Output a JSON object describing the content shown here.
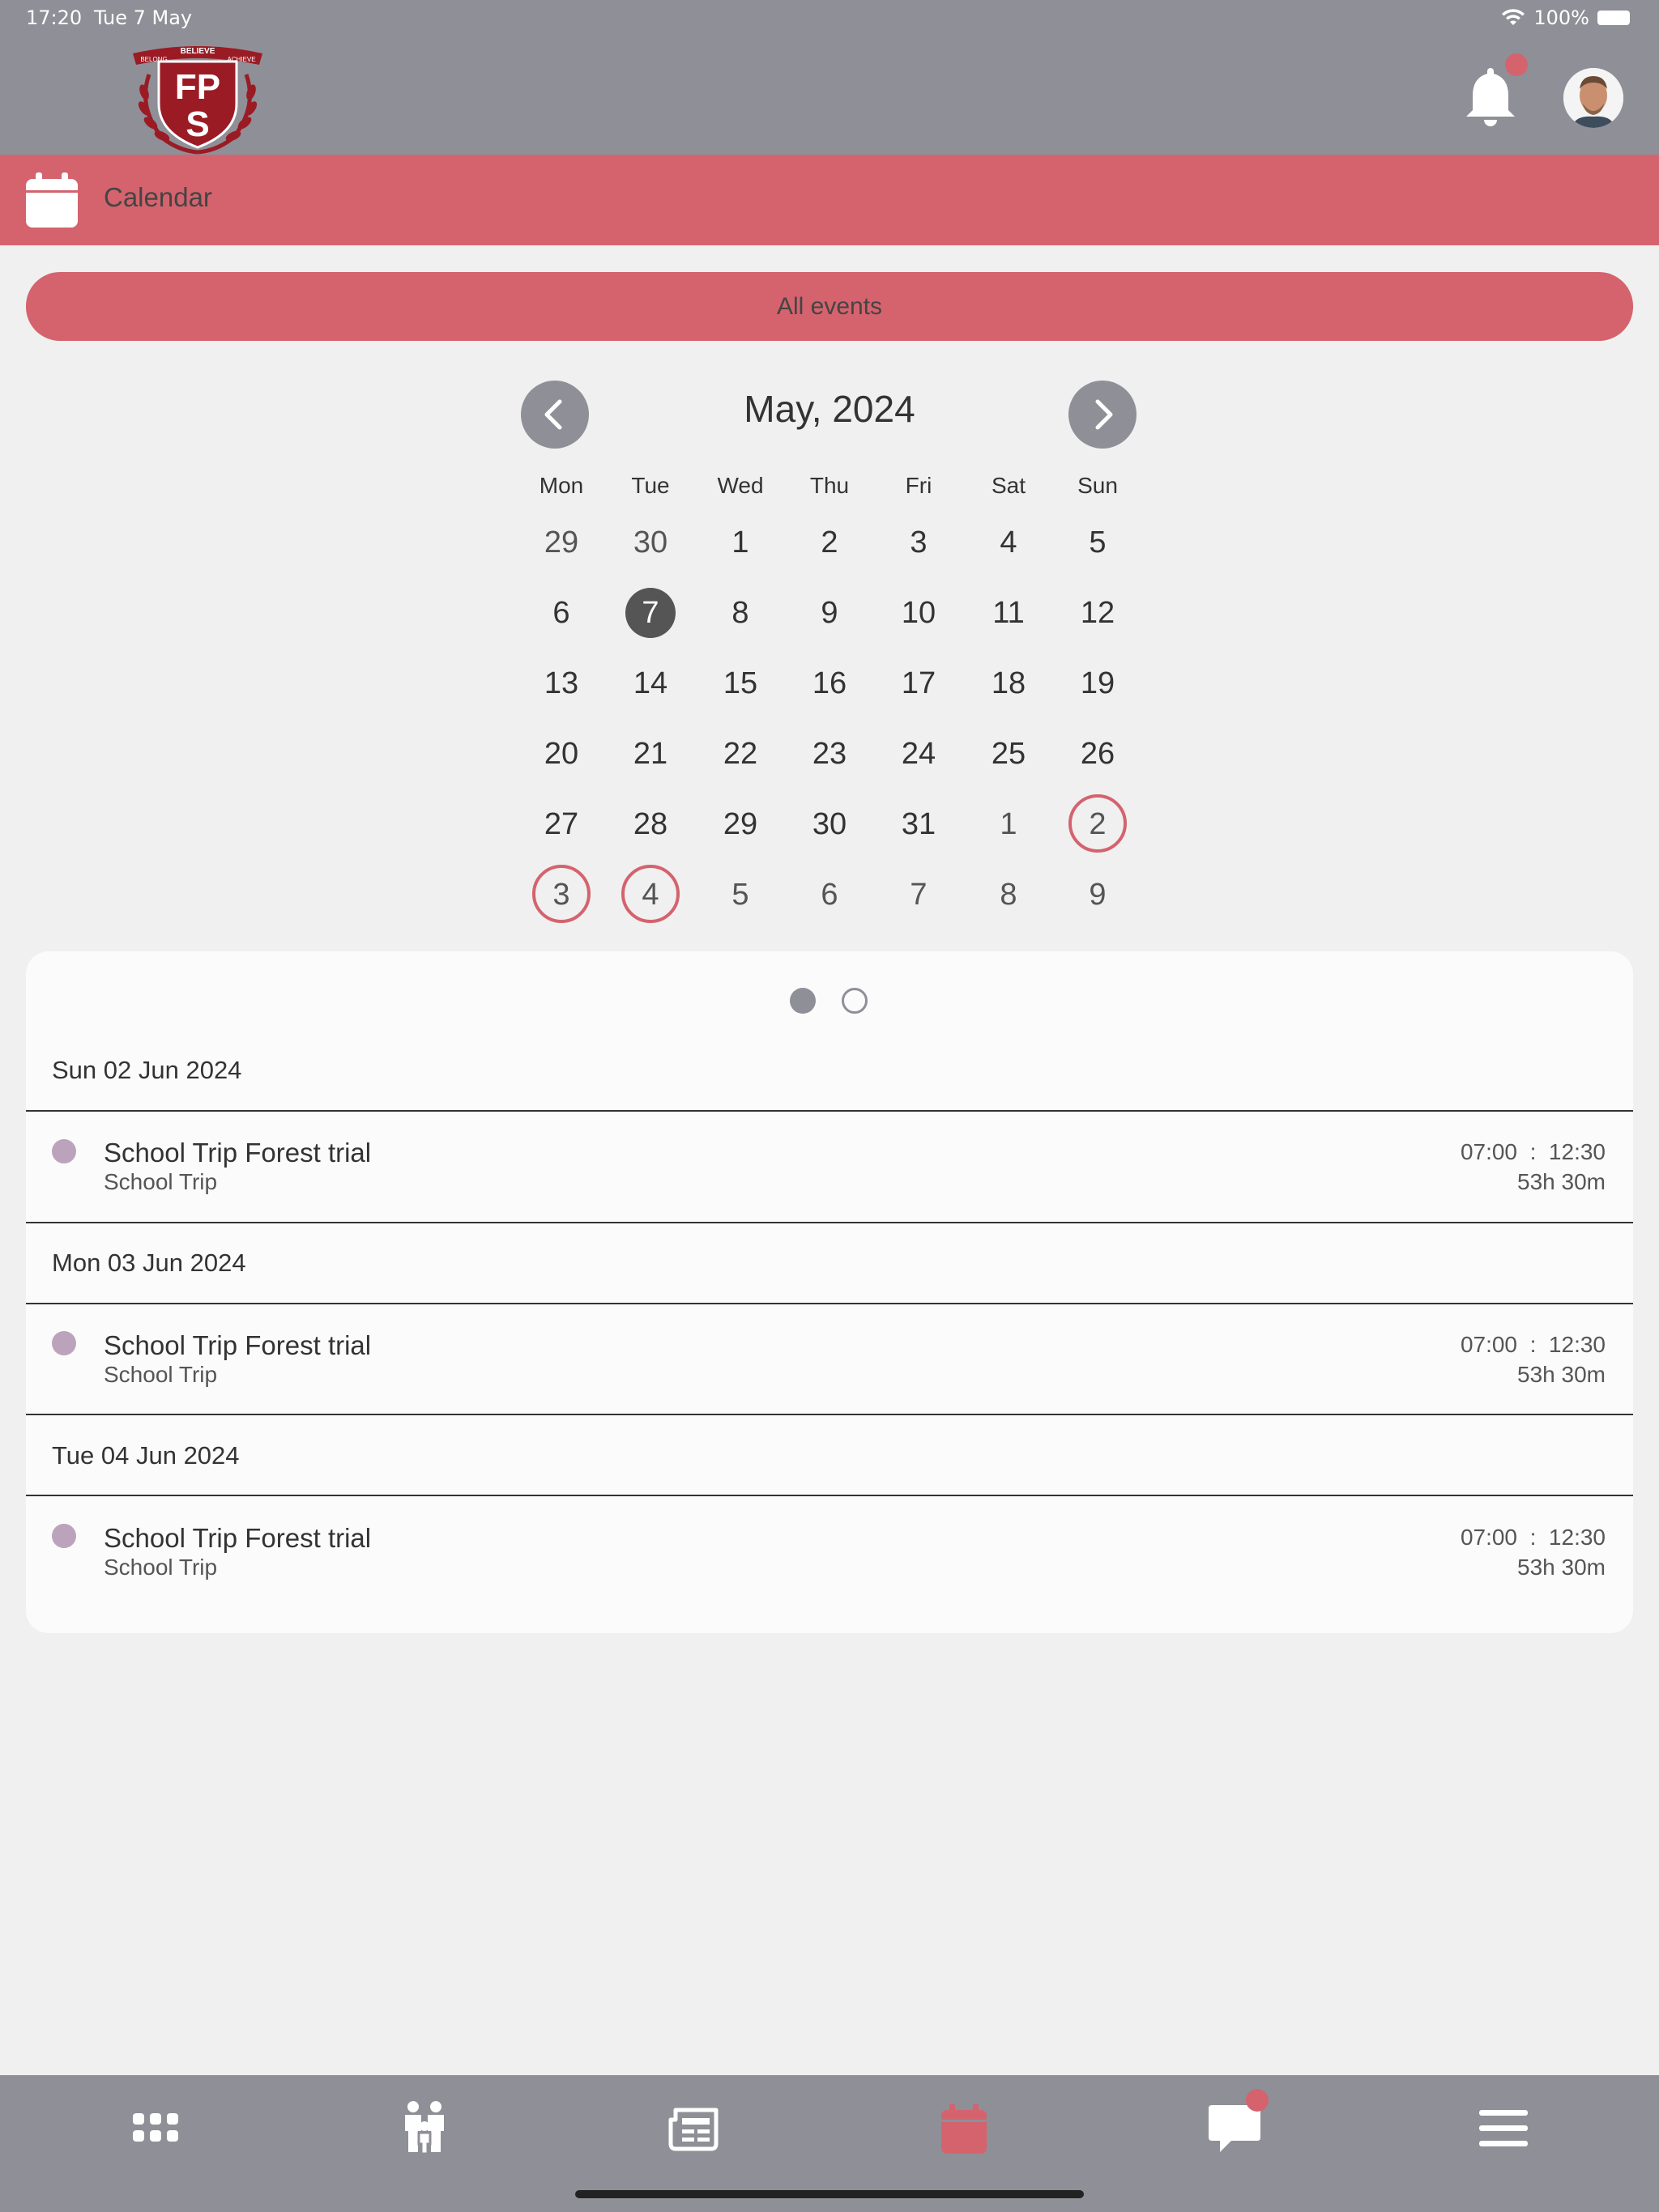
{
  "status_bar": {
    "time": "17:20",
    "date": "Tue 7 May",
    "battery": "100%"
  },
  "header": {
    "logo_text": {
      "top": "BELIEVE",
      "left": "BELONG",
      "right": "ACHIEVE",
      "initials_top": "FP",
      "initials_bottom": "S"
    }
  },
  "section": {
    "title": "Calendar"
  },
  "filter": {
    "label": "All events"
  },
  "calendar": {
    "month_title": "May, 2024",
    "weekdays": [
      "Mon",
      "Tue",
      "Wed",
      "Thu",
      "Fri",
      "Sat",
      "Sun"
    ],
    "weeks": [
      [
        "29",
        "30",
        "1",
        "2",
        "3",
        "4",
        "5"
      ],
      [
        "6",
        "7",
        "8",
        "9",
        "10",
        "11",
        "12"
      ],
      [
        "13",
        "14",
        "15",
        "16",
        "17",
        "18",
        "19"
      ],
      [
        "20",
        "21",
        "22",
        "23",
        "24",
        "25",
        "26"
      ],
      [
        "27",
        "28",
        "29",
        "30",
        "31",
        "1",
        "2"
      ],
      [
        "3",
        "4",
        "5",
        "6",
        "7",
        "8",
        "9"
      ]
    ]
  },
  "events": {
    "groups": [
      {
        "date": "Sun 02 Jun 2024",
        "title": "School Trip Forest trial",
        "type": "School Trip",
        "start": "07:00",
        "end": "12:30",
        "duration": "53h 30m"
      },
      {
        "date": "Mon 03 Jun 2024",
        "title": "School Trip Forest trial",
        "type": "School Trip",
        "start": "07:00",
        "end": "12:30",
        "duration": "53h 30m"
      },
      {
        "date": "Tue 04 Jun 2024",
        "title": "School Trip Forest trial",
        "type": "School Trip",
        "start": "07:00",
        "end": "12:30",
        "duration": "53h 30m"
      }
    ]
  },
  "colors": {
    "accent": "#d4636e",
    "chrome": "#8f8f97",
    "event_dot": "#bba3bb",
    "background": "#f0f0f0"
  },
  "tabbar": {
    "items": [
      "grid-icon",
      "family-icon",
      "newspaper-icon",
      "calendar-icon",
      "chat-icon",
      "menu-icon"
    ],
    "active": "calendar-icon"
  }
}
